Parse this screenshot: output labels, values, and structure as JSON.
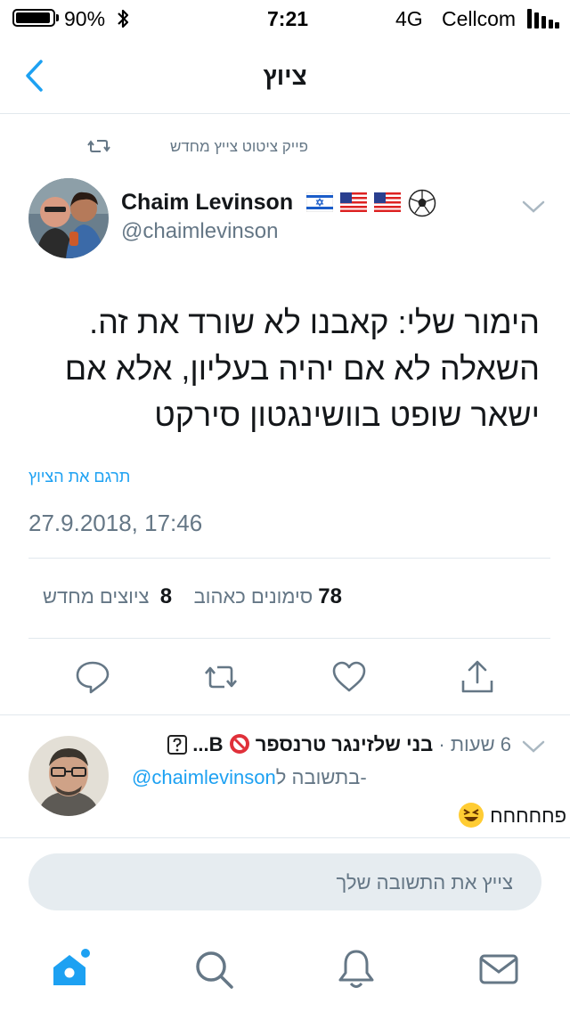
{
  "status_bar": {
    "battery_percent": "90%",
    "time": "7:21",
    "network": "4G",
    "carrier": "Cellcom",
    "battery_level": 0.9
  },
  "nav": {
    "title": "ציוץ"
  },
  "tweet": {
    "retweet_context": "פייק ציטוט צייץ מחדש",
    "author_name": "Chaim Levinson",
    "author_emojis": [
      "israel-flag",
      "us-flag",
      "us-flag",
      "soccer-ball"
    ],
    "author_handle": "@chaimlevinson",
    "text_lines": [
      "הימור שלי: קאבנו לא שורד את זה.",
      "השאלה לא אם יהיה בעליון, אלא אם",
      "ישאר שופט בוושינגטון סירקט"
    ],
    "translate_link": "תרגם את הציוץ",
    "timestamp": "27.9.2018, 17:46",
    "likes_count": "78",
    "likes_label": "סימונים כאהוב",
    "retweets_count": "8",
    "retweets_label": "ציוצים מחדש"
  },
  "actions": [
    "reply-icon",
    "retweet-icon",
    "like-icon",
    "share-icon"
  ],
  "reply": {
    "time_ago": "6 שעות",
    "author_name": "בני שלזינגר טרנספר",
    "author_suffix": "B...",
    "in_reply_to_prefix": "בתשובה ל-",
    "in_reply_to_handle": "@chaimlevinson",
    "text": "פחחחחח"
  },
  "compose": {
    "placeholder": "צייץ את התשובה שלך"
  },
  "tabs": [
    "home-icon",
    "search-icon",
    "notifications-icon",
    "messages-icon"
  ],
  "colors": {
    "accent": "#1da1f2",
    "secondary_text": "#657786",
    "divider": "#e1e8ed",
    "compose_bg": "#e6ecf0"
  }
}
